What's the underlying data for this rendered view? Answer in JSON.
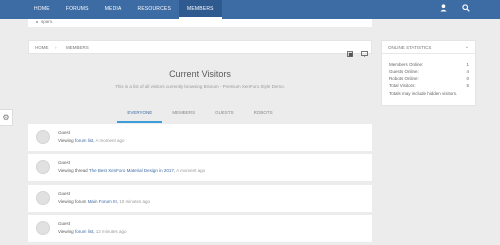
{
  "nav": {
    "items": [
      {
        "label": "Home",
        "active": false
      },
      {
        "label": "Forums",
        "active": false
      },
      {
        "label": "Media",
        "active": false
      },
      {
        "label": "Resources",
        "active": false
      },
      {
        "label": "Members",
        "active": true
      }
    ],
    "icons": [
      "user-icon",
      "search-icon"
    ]
  },
  "notice": {
    "text": "spam."
  },
  "breadcrumb": {
    "home": "Home",
    "current": "Members",
    "icons": [
      "bookmark-icon",
      "screen-icon"
    ]
  },
  "page": {
    "title": "Current Visitors",
    "subtitle": "This is a list of all visitors currently browsing Brivium - Premium XenForo Style Demo."
  },
  "tabs": [
    {
      "label": "Everyone",
      "active": true
    },
    {
      "label": "Members",
      "active": false
    },
    {
      "label": "Guests",
      "active": false
    },
    {
      "label": "Robots",
      "active": false
    }
  ],
  "visitors": [
    {
      "name": "Guest",
      "prefix": "Viewing ",
      "link": "forum list",
      "suffix": ", ",
      "time": "A moment ago"
    },
    {
      "name": "Guest",
      "prefix": "Viewing thread ",
      "link": "The Best XenForo Material Design in 2017",
      "suffix": ", ",
      "time": "A moment ago"
    },
    {
      "name": "Guest",
      "prefix": "Viewing forum ",
      "link": "Main Forum III",
      "suffix": ", ",
      "time": "10 minutes ago"
    },
    {
      "name": "Guest",
      "prefix": "Viewing ",
      "link": "forum list",
      "suffix": ", ",
      "time": "12 minutes ago"
    }
  ],
  "sidebar": {
    "title": "Online Statistics",
    "stats": [
      {
        "label": "Members Online:",
        "value": "1"
      },
      {
        "label": "Guests Online:",
        "value": "4"
      },
      {
        "label": "Robots Online:",
        "value": "0"
      },
      {
        "label": "Total Visitors:",
        "value": "5"
      }
    ],
    "note": "Totals may include hidden visitors."
  },
  "colors": {
    "accent": "#3d6ba4",
    "tab_underline": "#3d9dd8"
  }
}
